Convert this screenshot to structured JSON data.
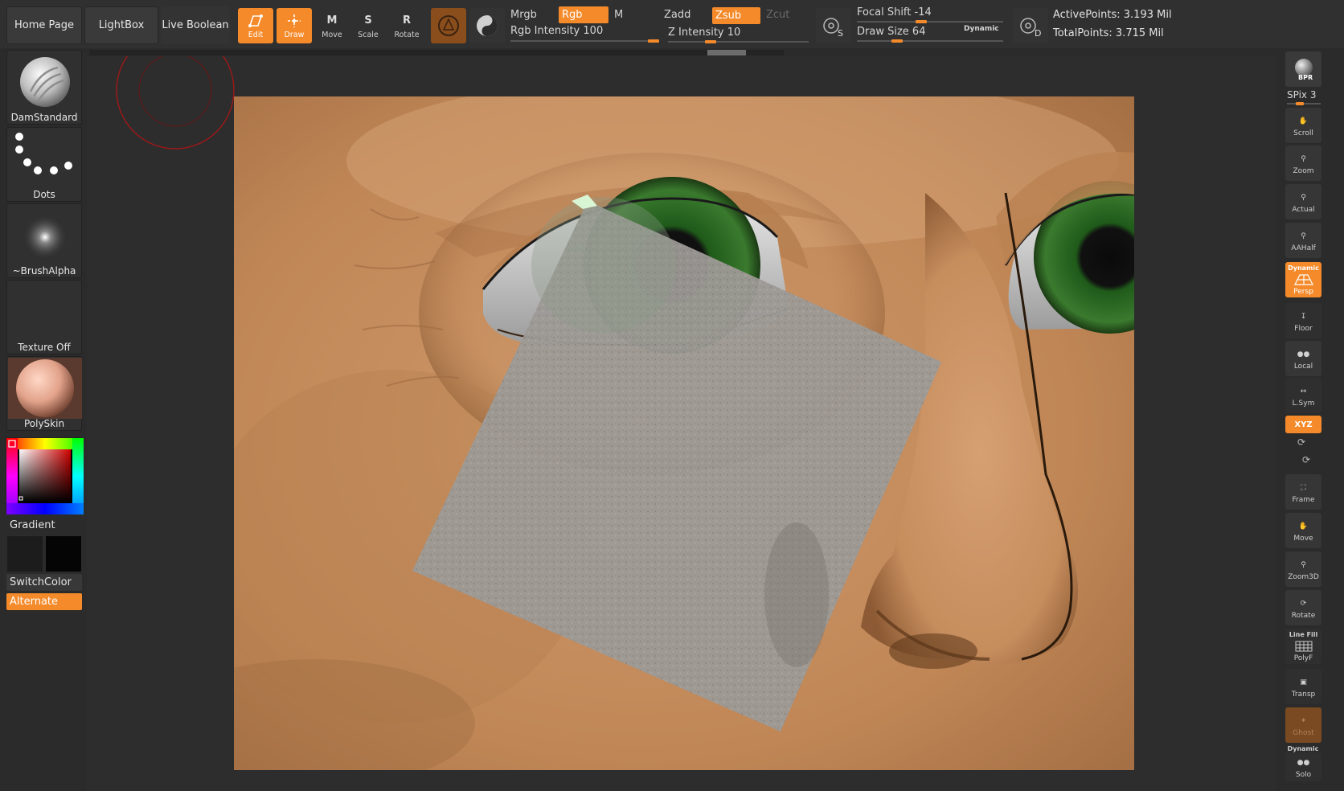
{
  "nav": {
    "home_page": "Home Page",
    "lightbox": "LightBox",
    "live_boolean": "Live Boolean"
  },
  "tools": {
    "edit": "Edit",
    "draw": "Draw",
    "move": "Move",
    "scale": "Scale",
    "rotate": "Rotate",
    "move_key": "M",
    "scale_key": "S",
    "rotate_key": "R"
  },
  "channels": {
    "mrgb": "Mrgb",
    "rgb": "Rgb",
    "m": "M",
    "rgb_intensity_label": "Rgb Intensity",
    "rgb_intensity_value": "100",
    "zadd": "Zadd",
    "zsub": "Zsub",
    "zcut": "Zcut",
    "z_intensity_label": "Z Intensity",
    "z_intensity_value": "10"
  },
  "brush": {
    "focal_shift_label": "Focal Shift",
    "focal_shift_value": "-14",
    "draw_size_label": "Draw Size",
    "draw_size_value": "64",
    "dynamic": "Dynamic",
    "s_key": "S",
    "d_key": "D"
  },
  "stats": {
    "active_points": "ActivePoints: 3.193 Mil",
    "total_points": "TotalPoints: 3.715 Mil"
  },
  "left_shelf": {
    "brush_name": "DamStandard",
    "stroke_name": "Dots",
    "alpha_name": "~BrushAlpha",
    "texture_name": "Texture Off",
    "material_name": "PolySkin",
    "gradient": "Gradient",
    "switch_color": "SwitchColor",
    "alternate": "Alternate"
  },
  "right_shelf": {
    "bpr": "BPR",
    "spix": "SPix 3",
    "scroll": "Scroll",
    "zoom": "Zoom",
    "actual": "Actual",
    "aahalf": "AAHalf",
    "dynamic_top": "Dynamic",
    "persp": "Persp",
    "floor": "Floor",
    "local": "Local",
    "lsym": "L.Sym",
    "xyz": "XYZ",
    "frame": "Frame",
    "move": "Move",
    "zoom3d": "Zoom3D",
    "rotate": "Rotate",
    "line_fill": "Line Fill",
    "polyf": "PolyF",
    "transp": "Transp",
    "ghost": "Ghost",
    "dynamic_solo": "Dynamic",
    "solo": "Solo"
  },
  "colors": {
    "accent": "#f48a2a",
    "panel": "#303030",
    "background": "#2b2b2b",
    "skin": "#c48e62"
  },
  "icons": {
    "edit": "edit-icon",
    "draw": "draw-icon",
    "move": "move-icon",
    "scale": "scale-icon",
    "rotate": "rotate-icon",
    "material_sphere": "material-sphere-icon",
    "shading_sphere": "shading-sphere-icon"
  }
}
